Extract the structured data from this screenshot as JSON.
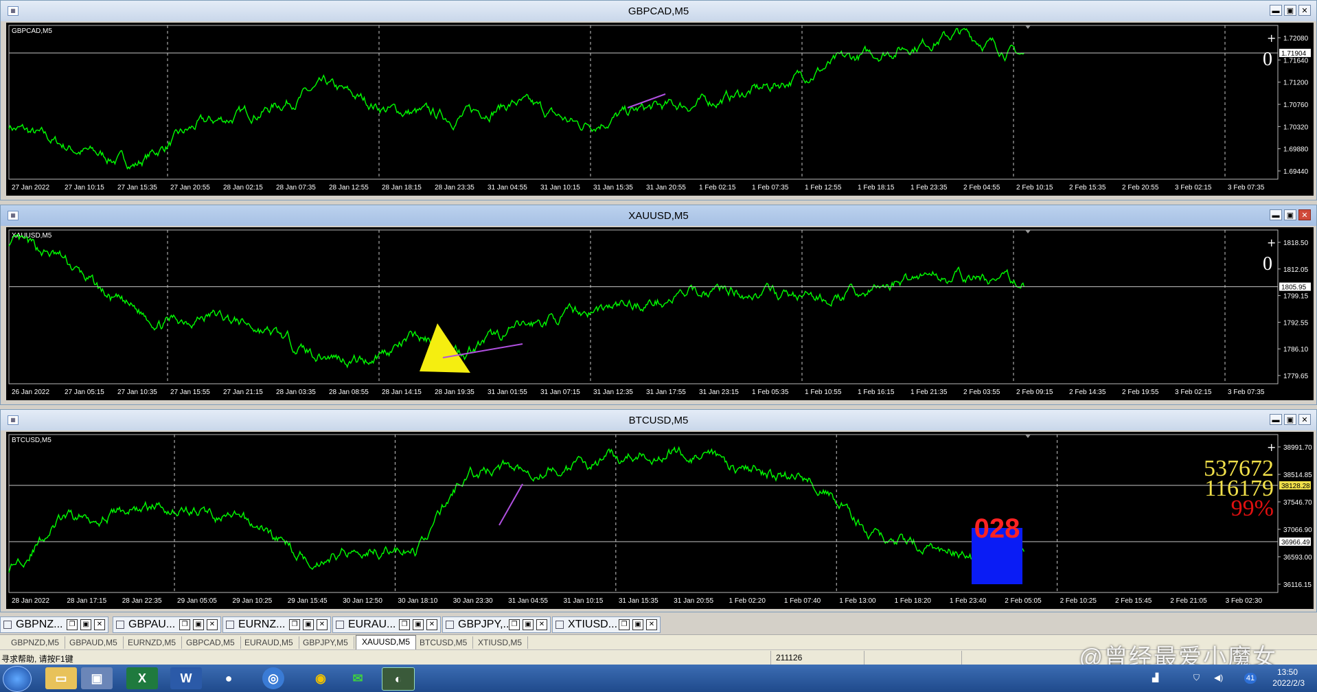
{
  "windows": [
    {
      "title": "GBPCAD,M5",
      "symbol_label": "GBPCAD,M5",
      "price_labels": [
        "1.72080",
        "1.71640",
        "1.71200",
        "1.70760",
        "1.70320",
        "1.69880",
        "1.69440"
      ],
      "current_price": "1.71904",
      "time_labels": [
        "27 Jan 2022",
        "27 Jan 10:15",
        "27 Jan 15:35",
        "27 Jan 20:55",
        "28 Jan 02:15",
        "28 Jan 07:35",
        "28 Jan 12:55",
        "28 Jan 18:15",
        "28 Jan 23:35",
        "31 Jan 04:55",
        "31 Jan 10:15",
        "31 Jan 15:35",
        "31 Jan 20:55",
        "1 Feb 02:15",
        "1 Feb 07:35",
        "1 Feb 12:55",
        "1 Feb 18:15",
        "1 Feb 23:35",
        "2 Feb 04:55",
        "2 Feb 10:15",
        "2 Feb 15:35",
        "2 Feb 20:55",
        "3 Feb 02:15",
        "3 Feb 07:35"
      ],
      "side_text": [
        "0"
      ],
      "y_range": [
        1.6944,
        1.723
      ],
      "series_seed": 7,
      "trend": [
        0.35,
        0.2,
        0.1,
        0.35,
        0.45,
        0.6,
        0.45,
        0.4,
        0.5,
        0.35,
        0.45,
        0.5,
        0.6,
        0.75,
        0.85,
        0.95,
        0.8
      ],
      "active": false
    },
    {
      "title": "XAUUSD,M5",
      "symbol_label": "XAUUSD,M5",
      "price_labels": [
        "1818.50",
        "1812.05",
        "1799.15",
        "1792.55",
        "1786.10",
        "1779.65"
      ],
      "current_price": "1805.95",
      "time_labels": [
        "26 Jan 2022",
        "27 Jan 05:15",
        "27 Jan 10:35",
        "27 Jan 15:55",
        "27 Jan 21:15",
        "28 Jan 03:35",
        "28 Jan 08:55",
        "28 Jan 14:15",
        "28 Jan 19:35",
        "31 Jan 01:55",
        "31 Jan 07:15",
        "31 Jan 12:35",
        "31 Jan 17:55",
        "31 Jan 23:15",
        "1 Feb 05:35",
        "1 Feb 10:55",
        "1 Feb 16:15",
        "1 Feb 21:35",
        "2 Feb 03:55",
        "2 Feb 09:15",
        "2 Feb 14:35",
        "2 Feb 19:55",
        "3 Feb 02:15",
        "3 Feb 07:35"
      ],
      "side_text": [
        "0"
      ],
      "y_range": [
        1778.0,
        1824.0
      ],
      "series_seed": 13,
      "trend": [
        0.92,
        0.82,
        0.55,
        0.4,
        0.45,
        0.35,
        0.2,
        0.15,
        0.3,
        0.22,
        0.35,
        0.45,
        0.5,
        0.55,
        0.62,
        0.58,
        0.55,
        0.6,
        0.72,
        0.68,
        0.65
      ],
      "active": true
    },
    {
      "title": "BTCUSD,M5",
      "symbol_label": "BTCUSD,M5",
      "price_labels": [
        "38991.70",
        "38514.85",
        "37546.70",
        "37066.90",
        "36593.00",
        "36116.15"
      ],
      "current_price": "38128.28",
      "second_price": "36966.49",
      "time_labels": [
        "28 Jan 2022",
        "28 Jan 17:15",
        "28 Jan 22:35",
        "29 Jan 05:05",
        "29 Jan 10:25",
        "29 Jan 15:45",
        "30 Jan 12:50",
        "30 Jan 18:10",
        "30 Jan 23:30",
        "31 Jan 04:55",
        "31 Jan 10:15",
        "31 Jan 15:35",
        "31 Jan 20:55",
        "1 Feb 02:20",
        "1 Feb 07:40",
        "1 Feb 13:00",
        "1 Feb 18:20",
        "1 Feb 23:40",
        "2 Feb 05:05",
        "2 Feb 10:25",
        "2 Feb 15:45",
        "2 Feb 21:05",
        "3 Feb 02:30"
      ],
      "side_text": [
        "537672",
        "116179",
        "99%"
      ],
      "box_label": "028",
      "y_range": [
        36000.0,
        39400.0
      ],
      "series_seed": 29,
      "trend": [
        0.15,
        0.45,
        0.5,
        0.55,
        0.5,
        0.4,
        0.2,
        0.3,
        0.25,
        0.75,
        0.8,
        0.78,
        0.85,
        0.9,
        0.82,
        0.75,
        0.7,
        0.35,
        0.3,
        0.22,
        0.25
      ],
      "active": false
    }
  ],
  "task_buttons": [
    "GBPNZ...",
    "GBPAU...",
    "EURNZ...",
    "EURAU...",
    "GBPJPY,...",
    "XTIUSD..."
  ],
  "tabs": [
    "GBPNZD,M5",
    "GBPAUD,M5",
    "EURNZD,M5",
    "GBPCAD,M5",
    "EURAUD,M5",
    "GBPJPY,M5",
    "XAUUSD,M5",
    "BTCUSD,M5",
    "XTIUSD,M5"
  ],
  "selected_tab": "XAUUSD,M5",
  "status": {
    "help": "寻求帮助, 请按F1键",
    "profile": "211126"
  },
  "watermark": "@曾经最爱小魔女",
  "tray": {
    "time": "13:50",
    "date": "2022/2/3",
    "badge": "41"
  },
  "colors": {
    "line": "#00ff00",
    "grid": "#c8c8c8",
    "side_yellow": "#f2e14a",
    "side_red": "#e01010",
    "box_blue": "#0a1cf5",
    "box_text": "#ff2222",
    "triangle": "#f5ee10",
    "trend_line": "#b050e0"
  }
}
